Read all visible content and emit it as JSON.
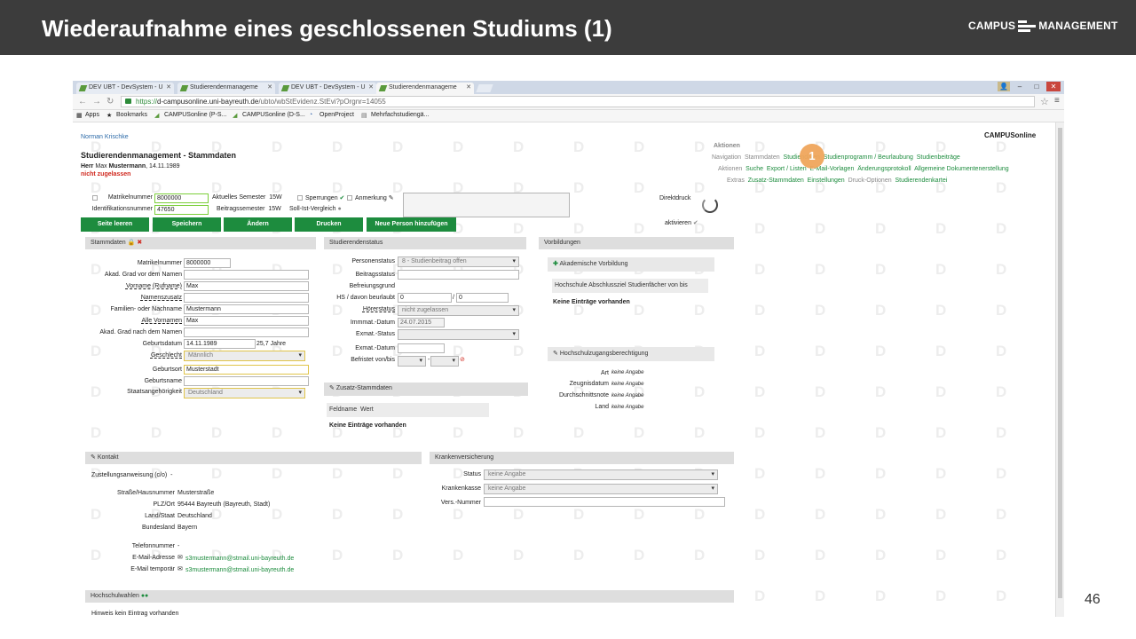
{
  "slide": {
    "title": "Wiederaufnahme eines geschlossenen Studiums (1)",
    "logo_left": "CAMPUS",
    "logo_right": "MANAGEMENT",
    "page_number": "46"
  },
  "browser": {
    "tabs": [
      "DEV UBT - DevSystem - U",
      "Studierendenmanageme",
      "DEV UBT - DevSystem - U",
      "Studierendenmanageme"
    ],
    "url_scheme": "https://",
    "url_host": "d-campusonline.uni-bayreuth.de",
    "url_path": "/ubto/wbStEvidenz.StEvi?pOrgnr=14055",
    "bookmarks": [
      "Apps",
      "Bookmarks",
      "CAMPUSonline (P-S...",
      "CAMPUSonline (D-S...",
      "OpenProject",
      "Mehrfachstudiengä..."
    ]
  },
  "app": {
    "user": "Norman Krischke",
    "page_title": "Studierendenmanagement - Stammdaten",
    "person_prefix": "Herr",
    "person_firstname": "Max",
    "person_lastname": "Mustermann",
    "person_birth": ", 14.11.1989",
    "status_text": "nicht zugelassen",
    "brand": "CAMPUSonline",
    "marker": "1",
    "aktionen": {
      "title": "Aktionen",
      "row1_label": "Navigation",
      "row1": [
        "Stammdaten",
        "Studiendaten",
        "Studienprogramm / Beurlaubung",
        "Studienbeiträge"
      ],
      "row2_label": "Aktionen",
      "row2": [
        "Suche",
        "Export / Listen",
        "E-Mail-Vorlagen",
        "Änderungsprotokoll",
        "Allgemeine Dokumentenerstellung"
      ],
      "row3_label": "Extras",
      "row3": [
        "Zusatz-Stammdaten",
        "Einstellungen",
        "Druck-Optionen",
        "Studierendenkartei"
      ]
    },
    "top": {
      "matrikel_label": "Matrikelnummer",
      "matrikel_value": "8000000",
      "ident_label": "Identifikationsnummer",
      "ident_value": "47650",
      "semester_label": "Aktuelles Semester",
      "semester_value": "15W",
      "beitrag_label": "Beitragssemester",
      "beitrag_value": "15W",
      "sperrungen": "Sperrungen",
      "sollist": "Soll-Ist-Vergleich",
      "anmerkung": "Anmerkung",
      "direktdruck": "Direktdruck",
      "aktivieren": "aktivieren"
    },
    "buttons": [
      "Seite leeren",
      "Speichern",
      "Ändern",
      "Drucken",
      "Neue Person hinzufügen"
    ],
    "stammdaten": {
      "title": "Stammdaten",
      "matrikel_label": "Matrikelnummer",
      "matrikel_value": "8000000",
      "grad_vor_label": "Akad. Grad vor dem Namen",
      "vorname_label": "Vorname (Rufname)",
      "vorname_value": "Max",
      "namenszusatz_label": "Namenszusatz",
      "nachname_label": "Familien- oder Nachname",
      "nachname_value": "Mustermann",
      "alle_vornamen_label": "Alle Vornamen",
      "alle_vornamen_value": "Max",
      "grad_nach_label": "Akad. Grad nach dem Namen",
      "geburtsdatum_label": "Geburtsdatum",
      "geburtsdatum_value": "14.11.1989",
      "alter": "25,7 Jahre",
      "geschlecht_label": "Geschlecht",
      "geschlecht_value": "Männlich",
      "geburtsort_label": "Geburtsort",
      "geburtsort_value": "Musterstadt",
      "geburtsname_label": "Geburtsname",
      "staat_label": "Staatsangehörigkeit",
      "staat_value": "Deutschland"
    },
    "status": {
      "title": "Studierendenstatus",
      "personenstatus_label": "Personenstatus",
      "personenstatus_value": "8 - Studienbeitrag offen",
      "beitragsstatus_label": "Beitragsstatus",
      "befreiung_label": "Befreiungsgrund",
      "hs_label": "HS / davon beurlaubt",
      "hs_value1": "0",
      "hs_value2": "0",
      "hoerstatus_label": "Hörerstatus",
      "hoerstatus_value": "nicht zugelassen",
      "immat_label": "Immmat.-Datum",
      "immat_value": "24.07.2015",
      "exmat_status_label": "Exmat.-Status",
      "exmat_datum_label": "Exmat.-Datum",
      "befristet_label": "Befristet von/bis"
    },
    "zusatz": {
      "title": "Zusatz-Stammdaten",
      "col1": "Feldname",
      "col2": "Wert",
      "empty": "Keine Einträge vorhanden"
    },
    "vorbildungen": {
      "title": "Vorbildungen",
      "akad_title": "Akademische Vorbildung",
      "columns": "Hochschule  Abschlussziel  Studienfächer  von  bis",
      "empty": "Keine Einträge vorhanden",
      "hzb_title": "Hochschulzugangsberechtigung",
      "art_label": "Art",
      "art_value": "keine Angabe",
      "zeugnis_label": "Zeugnisdatum",
      "zeugnis_value": "keine Angabe",
      "durchschnitt_label": "Durchschnittsnote",
      "durchschnitt_value": "keine Angabe",
      "land_label": "Land",
      "land_value": "keine Angabe"
    },
    "kontakt": {
      "title": "Kontakt",
      "zustellung_label": "Zustellungsanweisung (c/o)",
      "zustellung_value": "-",
      "strasse_label": "Straße/Hausnummer",
      "strasse_value": "Musterstraße",
      "plz_label": "PLZ/Ort",
      "plz_value": "95444 Bayreuth (Bayreuth, Stadt)",
      "land_label": "Land/Staat",
      "land_value": "Deutschland",
      "bundesland_label": "Bundesland",
      "bundesland_value": "Bayern",
      "telefon_label": "Telefonnummer",
      "telefon_value": "-",
      "email_label": "E-Mail-Adresse",
      "email_value": "s3mustermann@stmail.uni-bayreuth.de",
      "email_temp_label": "E-Mail temporär",
      "email_temp_value": "s3mustermann@stmail.uni-bayreuth.de"
    },
    "kranken": {
      "title": "Krankenversicherung",
      "status_label": "Status",
      "status_value": "keine Angabe",
      "kasse_label": "Krankenkasse",
      "kasse_value": "keine Angabe",
      "vers_label": "Vers.-Nummer"
    },
    "hochschulwahlen": {
      "title": "Hochschulwahlen",
      "hinweis": "Hinweis  kein Eintrag vorhanden"
    }
  },
  "colors": {
    "header": "#3c3c3c",
    "green": "#1d8c3e",
    "marker": "#f0a65c",
    "red": "#d0271d"
  }
}
